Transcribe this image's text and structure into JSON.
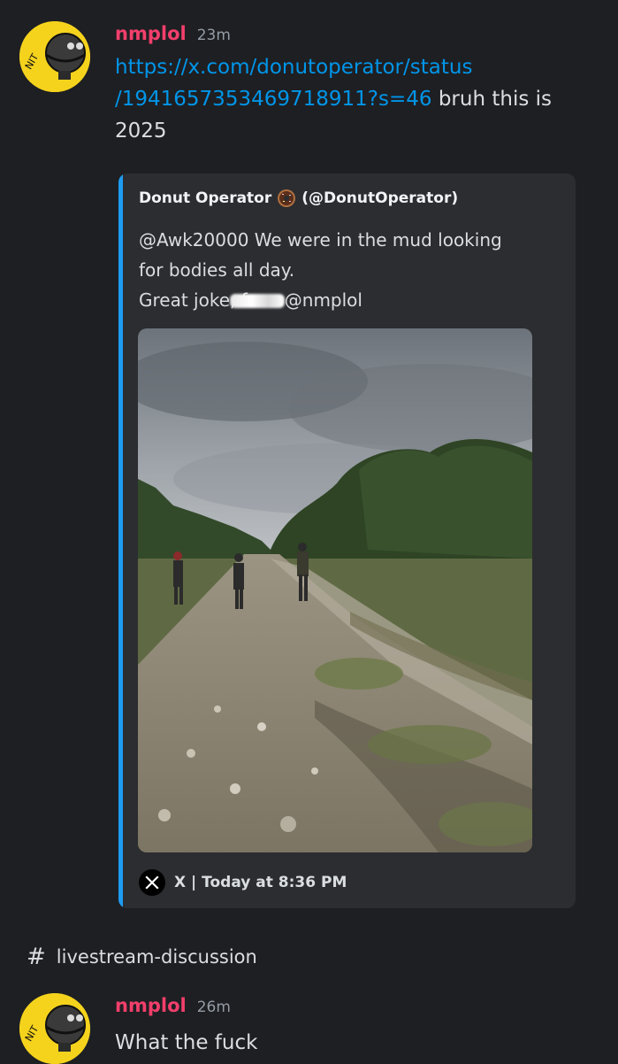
{
  "messages": [
    {
      "username": "nmplol",
      "time": "23m",
      "link_line1": "https://x.com/donutoperator/status",
      "link_line2": "/1941657353469718911?s=46",
      "text_after_link": " bruh this is",
      "text_line3": "2025"
    },
    {
      "username": "nmplol",
      "time": "26m",
      "text": "What the fuck"
    }
  ],
  "embed": {
    "author": "Donut Operator",
    "author_emoji": "donut-emoji",
    "author_handle": "(@DonutOperator)",
    "desc_line1": "@Awk20000 We were in the mud looking",
    "desc_line2": "for bodies all day.",
    "desc_line3_start": "Great joke, f",
    "desc_line3_end": "@nmplol",
    "footer": "X | Today at 8:36 PM",
    "footer_icon": "x-logo-icon",
    "accent_color": "#1d9bf0"
  },
  "channel": {
    "icon": "hash-icon",
    "name": "livestream-discussion"
  },
  "colors": {
    "background": "#1e1f23",
    "username": "#f23f6b",
    "link": "#0095e8",
    "avatar_yellow": "#f5d31c"
  }
}
